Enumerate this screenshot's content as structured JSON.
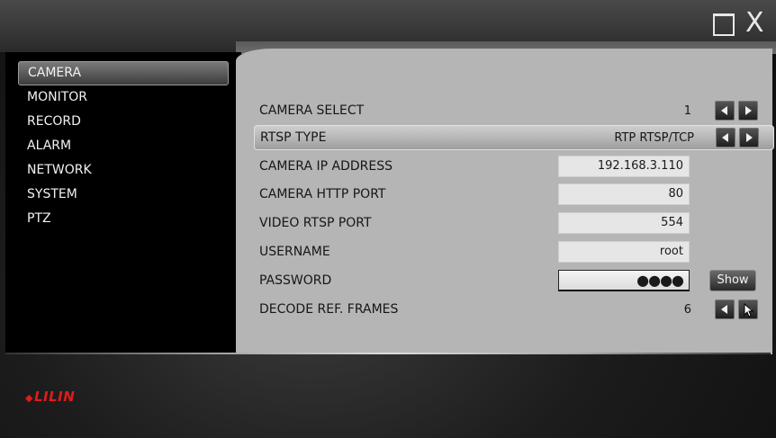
{
  "window": {
    "maximize_icon": "maximize-icon",
    "close_label": "X"
  },
  "sidebar": {
    "items": [
      {
        "label": "CAMERA",
        "active": true
      },
      {
        "label": "MONITOR",
        "active": false
      },
      {
        "label": "RECORD",
        "active": false
      },
      {
        "label": "ALARM",
        "active": false
      },
      {
        "label": "NETWORK",
        "active": false
      },
      {
        "label": "SYSTEM",
        "active": false
      },
      {
        "label": "PTZ",
        "active": false
      }
    ]
  },
  "form": {
    "camera_select": {
      "label": "CAMERA SELECT",
      "value": "1"
    },
    "rtsp_type": {
      "label": "RTSP TYPE",
      "value": "RTP RTSP/TCP"
    },
    "camera_ip": {
      "label": "CAMERA IP ADDRESS",
      "value": "192.168.3.110"
    },
    "http_port": {
      "label": "CAMERA HTTP PORT",
      "value": "80"
    },
    "rtsp_port": {
      "label": "VIDEO RTSP PORT",
      "value": "554"
    },
    "username": {
      "label": "USERNAME",
      "value": "root"
    },
    "password": {
      "label": "PASSWORD",
      "value": "●●●●",
      "show_label": "Show"
    },
    "decode_frames": {
      "label": "DECODE REF. FRAMES",
      "value": "6"
    }
  },
  "brand": {
    "logo_text": "LILIN",
    "color": "#e01b1b"
  },
  "colors": {
    "panel_bg": "#b5b5b5",
    "sidebar_bg": "#000000",
    "highlight_row": "#bdbdbd"
  }
}
